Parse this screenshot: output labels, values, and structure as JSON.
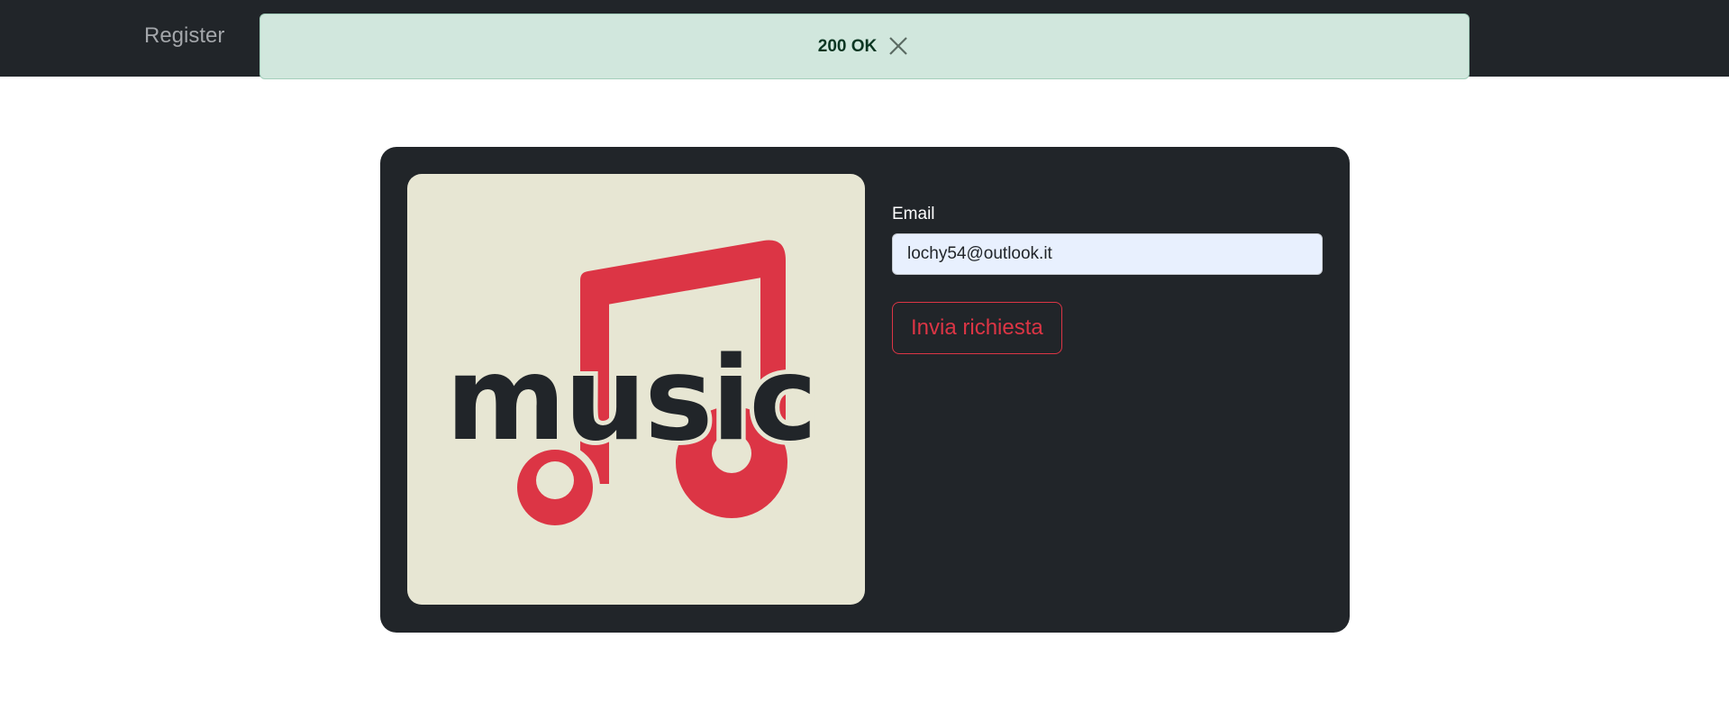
{
  "navbar": {
    "register_label": "Register"
  },
  "alert": {
    "message": "200 OK",
    "close_icon": "close-icon"
  },
  "logo": {
    "text": "music",
    "icon": "music-note-icon",
    "colors": {
      "background": "#e7e6d3",
      "note": "#dc3545",
      "text": "#212529"
    }
  },
  "form": {
    "email_label": "Email",
    "email_value": "lochy54@outlook.it",
    "submit_label": "Invia richiesta"
  },
  "colors": {
    "navbar_bg": "#212529",
    "alert_bg": "#d1e7dd",
    "card_bg": "#212529",
    "accent": "#dc3545"
  }
}
